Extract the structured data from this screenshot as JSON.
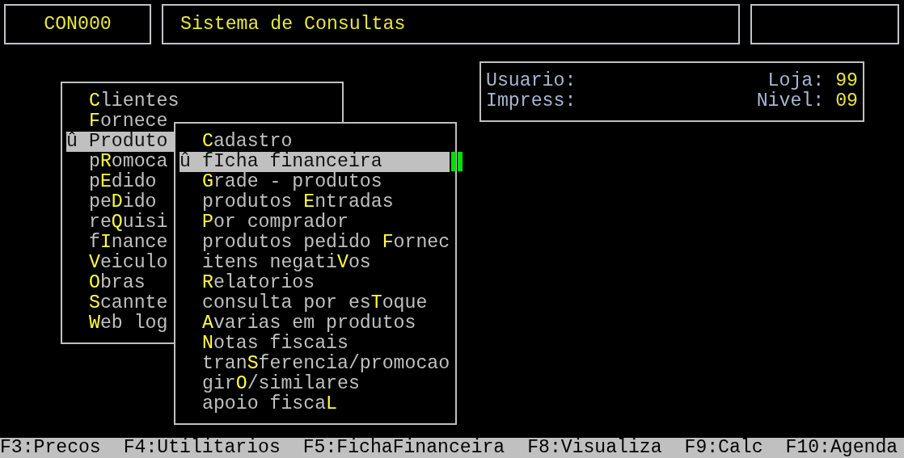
{
  "header": {
    "program_code": "CON000",
    "title": "Sistema de Consultas"
  },
  "info_panel": {
    "rows": [
      {
        "label": "Usuario:",
        "right_label": "Loja:",
        "right_value": "99"
      },
      {
        "label": "Impress:",
        "right_label": "Nivel:",
        "right_value": "09"
      }
    ]
  },
  "menus": [
    {
      "marker": "û",
      "items": [
        {
          "label": "**C**lientes",
          "selected": false
        },
        {
          "label": "**F**ornece",
          "selected": false
        },
        {
          "label": "Produto",
          "selected": true
        },
        {
          "label": "p**R**omoca",
          "selected": false
        },
        {
          "label": "p**E**dido",
          "selected": false
        },
        {
          "label": "pe**D**ido",
          "selected": false
        },
        {
          "label": "re**Q**uisi",
          "selected": false
        },
        {
          "label": "f**I**nance",
          "selected": false
        },
        {
          "label": "**V**eiculo",
          "selected": false
        },
        {
          "label": "**O**bras",
          "selected": false
        },
        {
          "label": "**S**cannte",
          "selected": false
        },
        {
          "label": "**W**eb log",
          "selected": false
        }
      ]
    },
    {
      "marker": "û",
      "items": [
        {
          "label": "**C**adastro",
          "selected": false
        },
        {
          "label": "fIcha financeira",
          "selected": true
        },
        {
          "label": "**G**rade - produtos",
          "selected": false
        },
        {
          "label": "produtos **E**ntradas",
          "selected": false
        },
        {
          "label": "**P**or comprador",
          "selected": false
        },
        {
          "label": "produtos pedido **F**ornec",
          "selected": false
        },
        {
          "label": "itens negati**V**os",
          "selected": false
        },
        {
          "label": "**R**elatorios",
          "selected": false
        },
        {
          "label": "consulta por es**T**oque",
          "selected": false
        },
        {
          "label": "**A**varias em produtos",
          "selected": false
        },
        {
          "label": "**N**otas fiscais",
          "selected": false
        },
        {
          "label": "tran**S**ferencia/promocao",
          "selected": false
        },
        {
          "label": "gir**O**/similares",
          "selected": false
        },
        {
          "label": "apoio fisca**L**",
          "selected": false
        }
      ]
    }
  ],
  "status_bar": [
    "F3:Precos",
    "F4:Utilitarios",
    "F5:FichaFinanceira",
    "F8:Visualiza",
    "F9:Calc",
    "F10:Agenda"
  ]
}
